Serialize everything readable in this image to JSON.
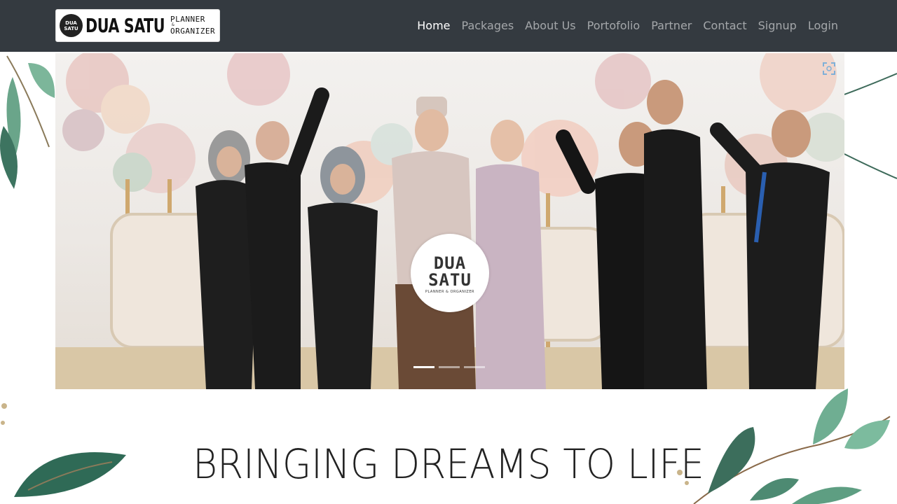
{
  "brand": {
    "badge_line1": "DUA",
    "badge_line2": "SATU",
    "name": "DUA SATU",
    "sub_line1": "PLANNER",
    "sub_amp": "&",
    "sub_line2": "ORGANIZER"
  },
  "nav": {
    "items": [
      {
        "label": "Home",
        "active": true
      },
      {
        "label": "Packages"
      },
      {
        "label": "About Us"
      },
      {
        "label": "Portofolio"
      },
      {
        "label": "Partner"
      },
      {
        "label": "Contact"
      },
      {
        "label": "Signup"
      },
      {
        "label": "Login"
      }
    ]
  },
  "carousel": {
    "center_logo": {
      "line1": "DUA",
      "line2": "SATU",
      "line3": "PLANNER & ORGANIZER"
    },
    "slides_count": 3,
    "active_slide": 1,
    "fullscreen_icon": "expand-icon"
  },
  "hero": {
    "tagline": "BRINGING DREAMS TO LIFE"
  },
  "colors": {
    "navbar_bg": "#343a40",
    "leaf_green": "#5a9a7a",
    "leaf_dark": "#2e5e4e"
  }
}
